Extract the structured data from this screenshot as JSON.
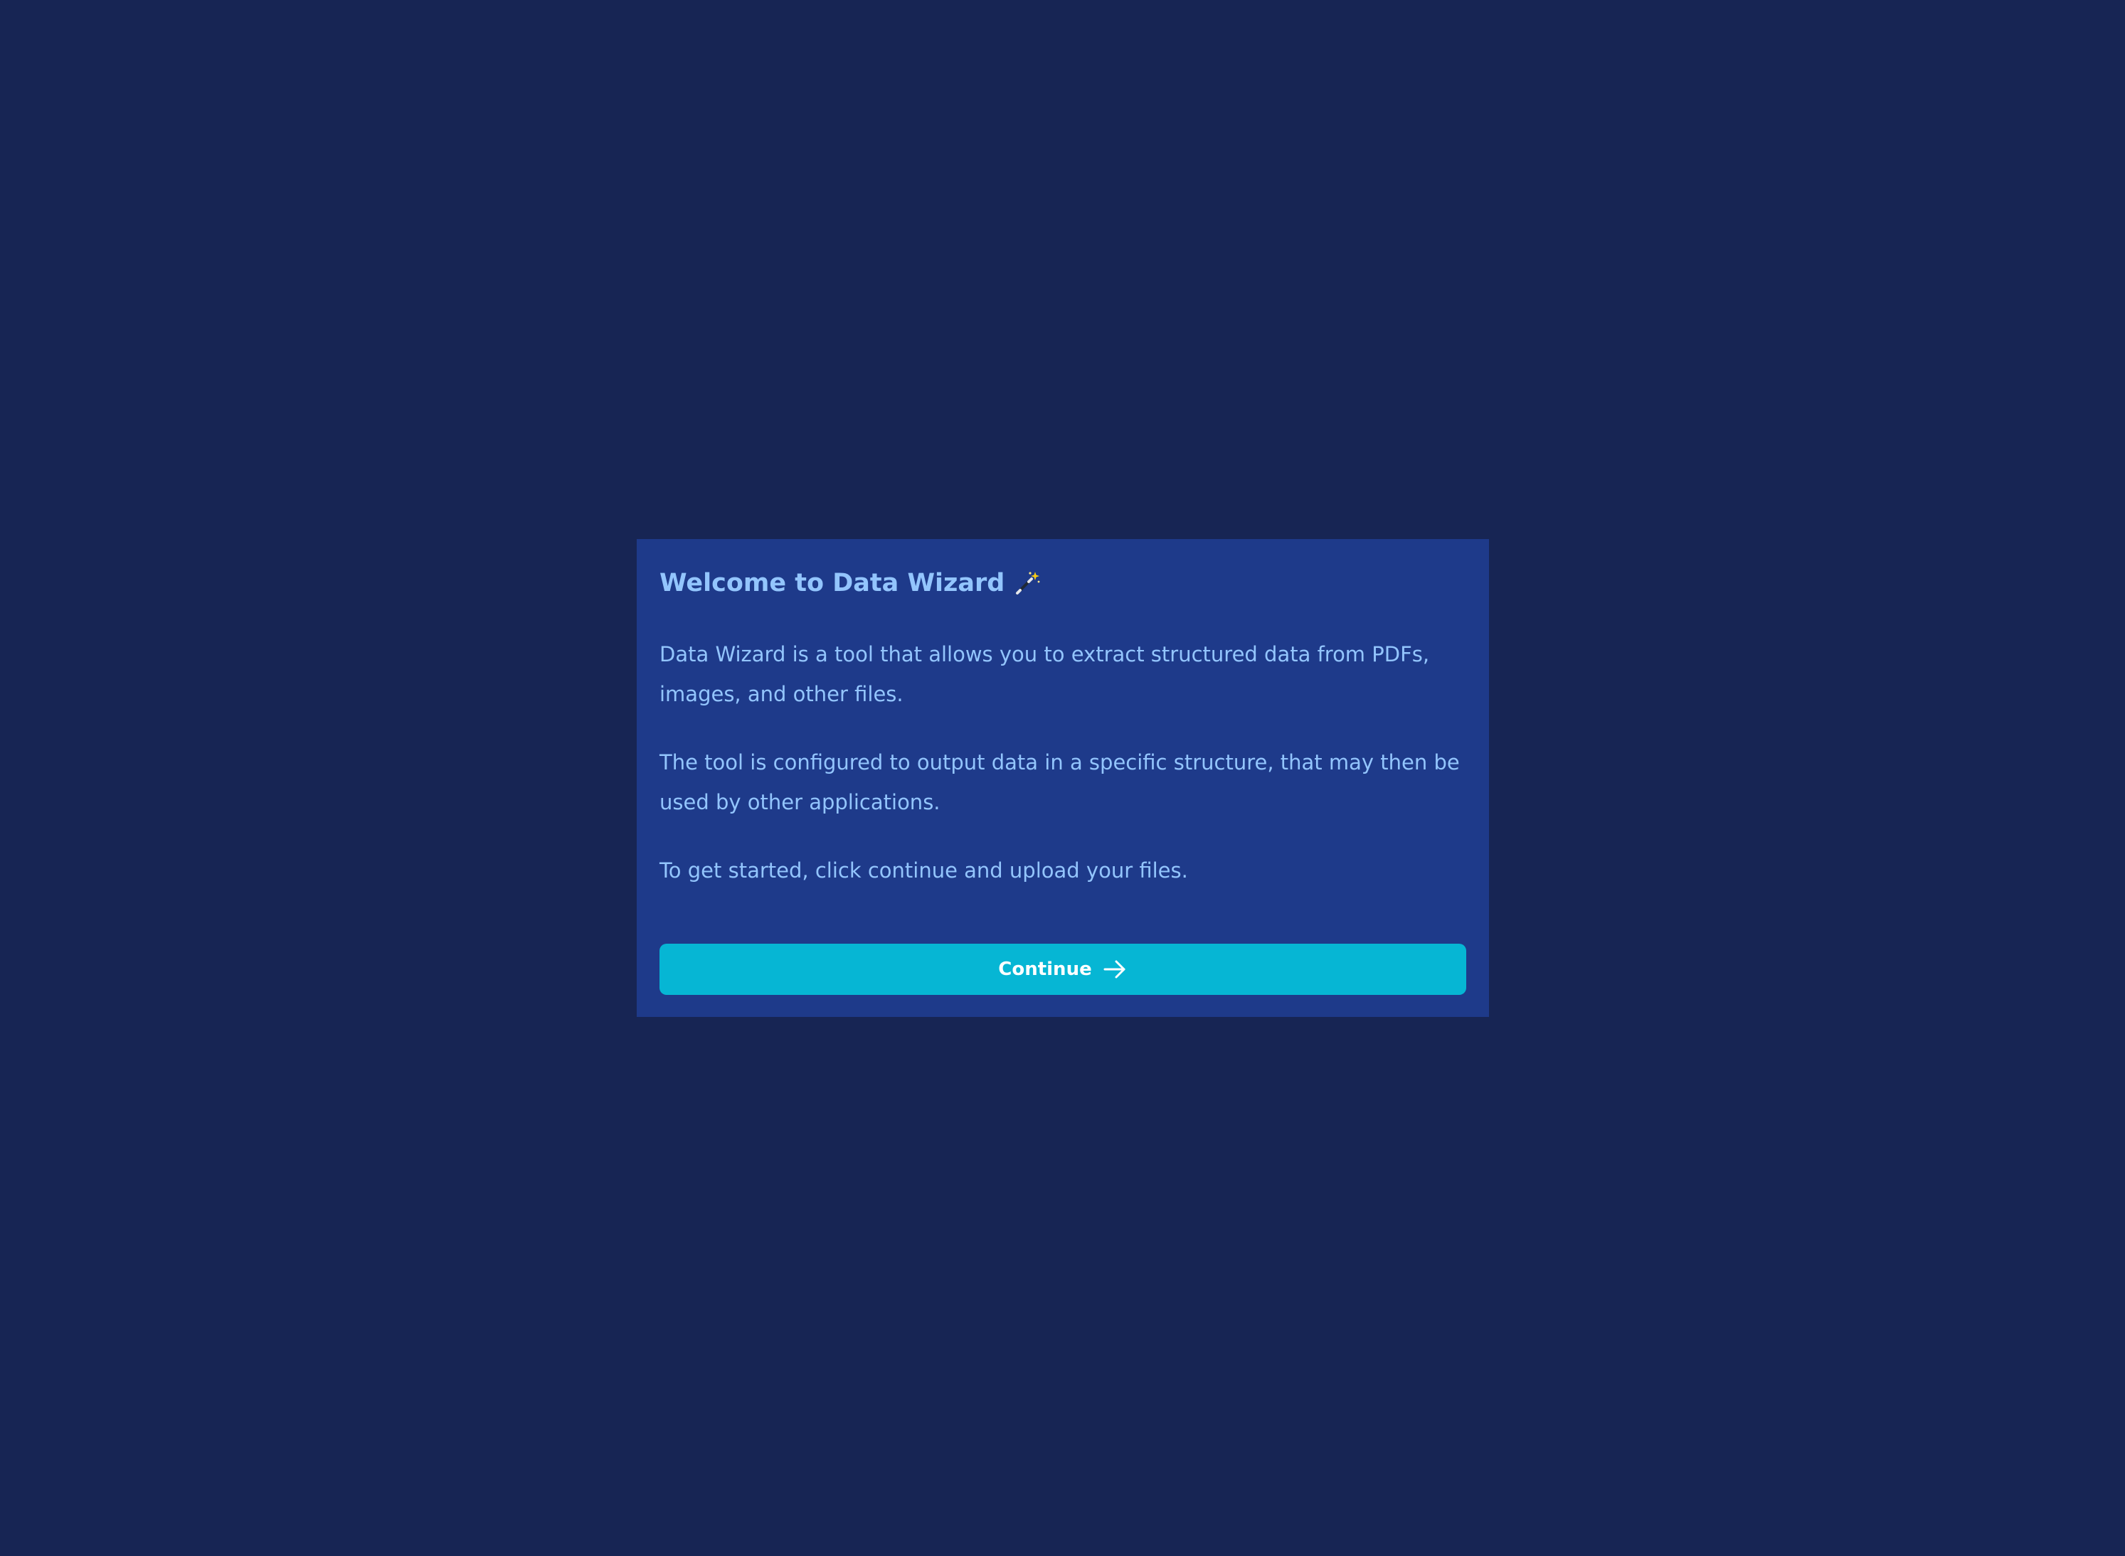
{
  "dialog": {
    "title": "Welcome to Data Wizard",
    "title_icon": "magic-wand-icon",
    "paragraphs": [
      "Data Wizard is a tool that allows you to extract structured data from PDFs, images, and other files.",
      "The tool is configured to output data in a specific structure, that may then be used by other applications.",
      "To get started, click continue and upload your files."
    ],
    "continue_label": "Continue",
    "continue_icon": "arrow-right-icon"
  },
  "colors": {
    "page_background": "#172554",
    "dialog_background": "#1e3a8a",
    "text": "#93c5fd",
    "button": "#06b6d4",
    "button_text": "#ffffff"
  }
}
